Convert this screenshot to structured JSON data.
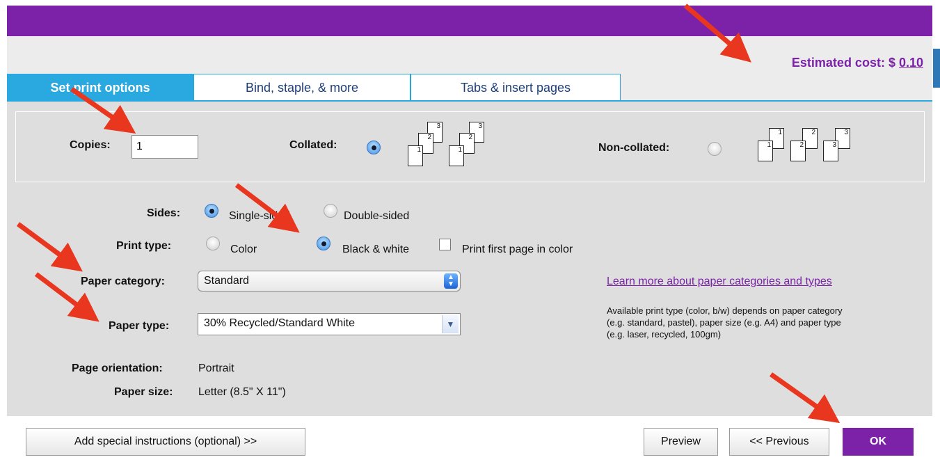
{
  "header": {
    "cost_label": "Estimated cost: $ ",
    "cost_value": "0.10"
  },
  "tabs": [
    {
      "label": "Set print options",
      "active": true
    },
    {
      "label": "Bind, staple, & more",
      "active": false
    },
    {
      "label": "Tabs & insert pages",
      "active": false
    }
  ],
  "copies": {
    "label": "Copies:",
    "value": "1",
    "collated_label": "Collated:",
    "collated_selected": true,
    "noncollated_label": "Non-collated:",
    "noncollated_selected": false,
    "collated_stack": [
      "1",
      "2",
      "3"
    ],
    "noncollated_pages": [
      "1",
      "1",
      "2",
      "2",
      "3",
      "3"
    ]
  },
  "sides": {
    "label": "Sides:",
    "single": "Single-sided",
    "double": "Double-sided",
    "selected": "single"
  },
  "print_type": {
    "label": "Print type:",
    "color": "Color",
    "bw": "Black & white",
    "selected": "bw",
    "first_page_color": "Print first page in color",
    "first_page_checked": false
  },
  "paper_category": {
    "label": "Paper category:",
    "value": "Standard"
  },
  "paper_type": {
    "label": "Paper type:",
    "value": "30% Recycled/Standard White"
  },
  "orientation": {
    "label": "Page orientation:",
    "value": "Portrait"
  },
  "paper_size": {
    "label": "Paper size:",
    "value": "Letter (8.5\" X 11\")"
  },
  "info": {
    "link": "Learn more about paper categories and types",
    "note_line1": "Available print type (color, b/w) depends on paper category",
    "note_line2": "(e.g. standard, pastel), paper size (e.g. A4) and paper type",
    "note_line3": "(e.g. laser, recycled, 100gm)"
  },
  "footer": {
    "special": "Add special instructions (optional) >>",
    "preview": "Preview",
    "previous": "<< Previous",
    "ok": "OK"
  },
  "colors": {
    "brand_purple": "#7b22a8",
    "tab_blue": "#29a9e0",
    "panel_gray": "#dedede",
    "annotation_red": "#e8371e"
  },
  "icons": [
    "radio-icon",
    "checkbox-icon",
    "page-stack-icon",
    "arrow-annotation-icon"
  ]
}
